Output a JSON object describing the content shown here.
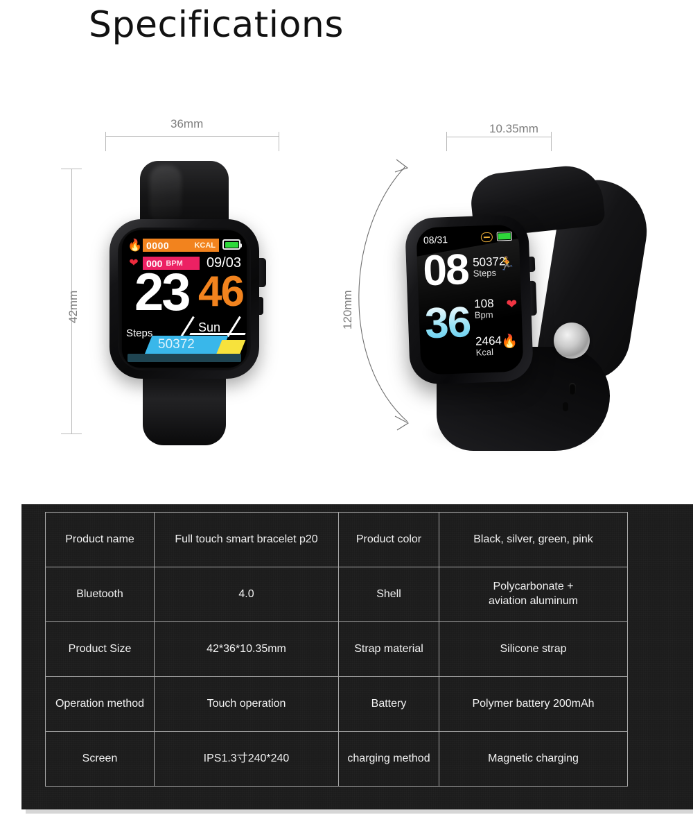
{
  "page": {
    "title": "Specifications"
  },
  "dimensions": {
    "width_label": "36mm",
    "height_label": "42mm",
    "thickness_label": "10.35mm",
    "strap_length_label": "120mm"
  },
  "watch_front": {
    "kcal_value": "0000",
    "kcal_unit": "KCAL",
    "bpm_value": "000",
    "bpm_unit": "BPM",
    "date": "09/03",
    "hour": "23",
    "minute": "46",
    "steps_label": "Steps",
    "steps_value": "50372",
    "weekday": "Sun",
    "flame_icon": "flame-icon",
    "heart_icon": "heart-icon",
    "battery_icon": "battery-icon"
  },
  "watch_side": {
    "date": "08/31",
    "hour": "08",
    "minute": "36",
    "steps_value": "50372",
    "steps_label": "Steps",
    "bpm_value": "108",
    "bpm_label": "Bpm",
    "kcal_value": "2464",
    "kcal_label": "Kcal",
    "bluetooth_icon": "bluetooth-icon",
    "battery_icon": "battery-icon",
    "run_icon": "running-icon",
    "heart_icon": "heart-icon",
    "flame_icon": "flame-icon"
  },
  "spec_table": {
    "rows": [
      {
        "label1": "Product name",
        "value1": "Full touch smart bracelet p20",
        "label2": "Product color",
        "value2": "Black, silver, green, pink"
      },
      {
        "label1": "Bluetooth",
        "value1": "4.0",
        "label2": "Shell",
        "value2": "Polycarbonate +\naviation aluminum"
      },
      {
        "label1": "Product Size",
        "value1": "42*36*10.35mm",
        "label2": "Strap material",
        "value2": "Silicone strap"
      },
      {
        "label1": "Operation method",
        "value1": "Touch operation",
        "label2": "Battery",
        "value2": "Polymer battery 200mAh"
      },
      {
        "label1": "Screen",
        "value1": "IPS1.3寸240*240",
        "label2": "charging method",
        "value2": "Magnetic charging"
      }
    ]
  },
  "colors": {
    "kcal_bar": "#f2831e",
    "bpm_bar": "#ec2163",
    "battery_green": "#2ed83a",
    "minute_orange": "#f2831e",
    "steps_cyan": "#39b7ea",
    "accent_yellow": "#f7e23c",
    "panel_bg": "#1c1c1c",
    "table_border": "#a8a8a8"
  }
}
